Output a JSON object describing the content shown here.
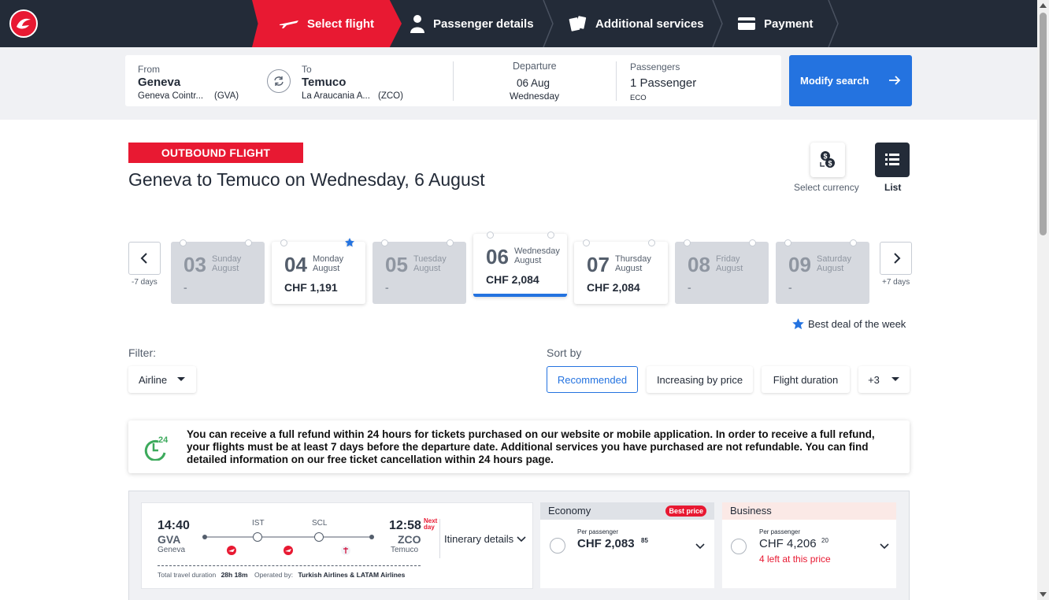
{
  "steps": [
    {
      "label": "Select flight"
    },
    {
      "label": "Passenger details"
    },
    {
      "label": "Additional services"
    },
    {
      "label": "Payment"
    }
  ],
  "search": {
    "from_label": "From",
    "from_city": "Geneva",
    "from_airport": "Geneva Cointr...",
    "from_code": "(GVA)",
    "to_label": "To",
    "to_city": "Temuco",
    "to_airport": "La Araucania A...",
    "to_code": "(ZCO)",
    "departure_label": "Departure",
    "departure_date": "06 Aug",
    "departure_day": "Wednesday",
    "passengers_label": "Passengers",
    "passengers_value": "1 Passenger",
    "cabin_class": "ECO",
    "modify_label": "Modify search"
  },
  "header": {
    "badge": "OUTBOUND FLIGHT",
    "title": "Geneva to Temuco on Wednesday, 6 August",
    "currency_label": "Select currency",
    "list_label": "List"
  },
  "dates": {
    "prev_caption": "-7 days",
    "next_caption": "+7 days",
    "days": [
      {
        "num": "03",
        "weekday": "Sunday",
        "month": "August",
        "price": "-"
      },
      {
        "num": "04",
        "weekday": "Monday",
        "month": "August",
        "price": "CHF 1,191"
      },
      {
        "num": "05",
        "weekday": "Tuesday",
        "month": "August",
        "price": "-"
      },
      {
        "num": "06",
        "weekday": "Wednesday",
        "month": "August",
        "price": "CHF 2,084"
      },
      {
        "num": "07",
        "weekday": "Thursday",
        "month": "August",
        "price": "CHF 2,084"
      },
      {
        "num": "08",
        "weekday": "Friday",
        "month": "August",
        "price": "-"
      },
      {
        "num": "09",
        "weekday": "Saturday",
        "month": "August",
        "price": "-"
      }
    ],
    "best_deal_label": "Best deal of the week"
  },
  "filters": {
    "filter_label": "Filter:",
    "airline_label": "Airline",
    "sort_label": "Sort by",
    "sort_options": [
      "Recommended",
      "Increasing by price",
      "Flight duration",
      "+3"
    ]
  },
  "refund": {
    "badge": "24",
    "text": "You can receive a full refund within 24 hours for tickets purchased on our website or mobile application. In order to receive a full refund, your flights must be at least 7 days before the departure date. Additional services you have purchased are not refundable. You can find detailed information on our free ticket cancellation within 24 hours page."
  },
  "flight": {
    "dep_time": "14:40",
    "dep_code": "GVA",
    "dep_city": "Geneva",
    "arr_time": "12:58",
    "arr_code": "ZCO",
    "arr_city": "Temuco",
    "next_day": "Next day",
    "stop1": "IST",
    "stop2": "SCL",
    "itinerary_label": "Itinerary details",
    "total_label": "Total travel duration",
    "total_value": "28h 18m",
    "operated_label": "Operated by:",
    "operated_value": "Turkish Airlines & LATAM Airlines"
  },
  "fares": {
    "economy": {
      "label": "Economy",
      "badge": "Best price",
      "per": "Per passenger",
      "price": "CHF 2,083",
      "cents": "85"
    },
    "business": {
      "label": "Business",
      "per": "Per passenger",
      "price": "CHF 4,206",
      "cents": "20",
      "note": "4 left at this price"
    }
  },
  "colors": {
    "brand_red": "#e81932",
    "accent_blue": "#2473e0",
    "dark": "#232b38"
  }
}
